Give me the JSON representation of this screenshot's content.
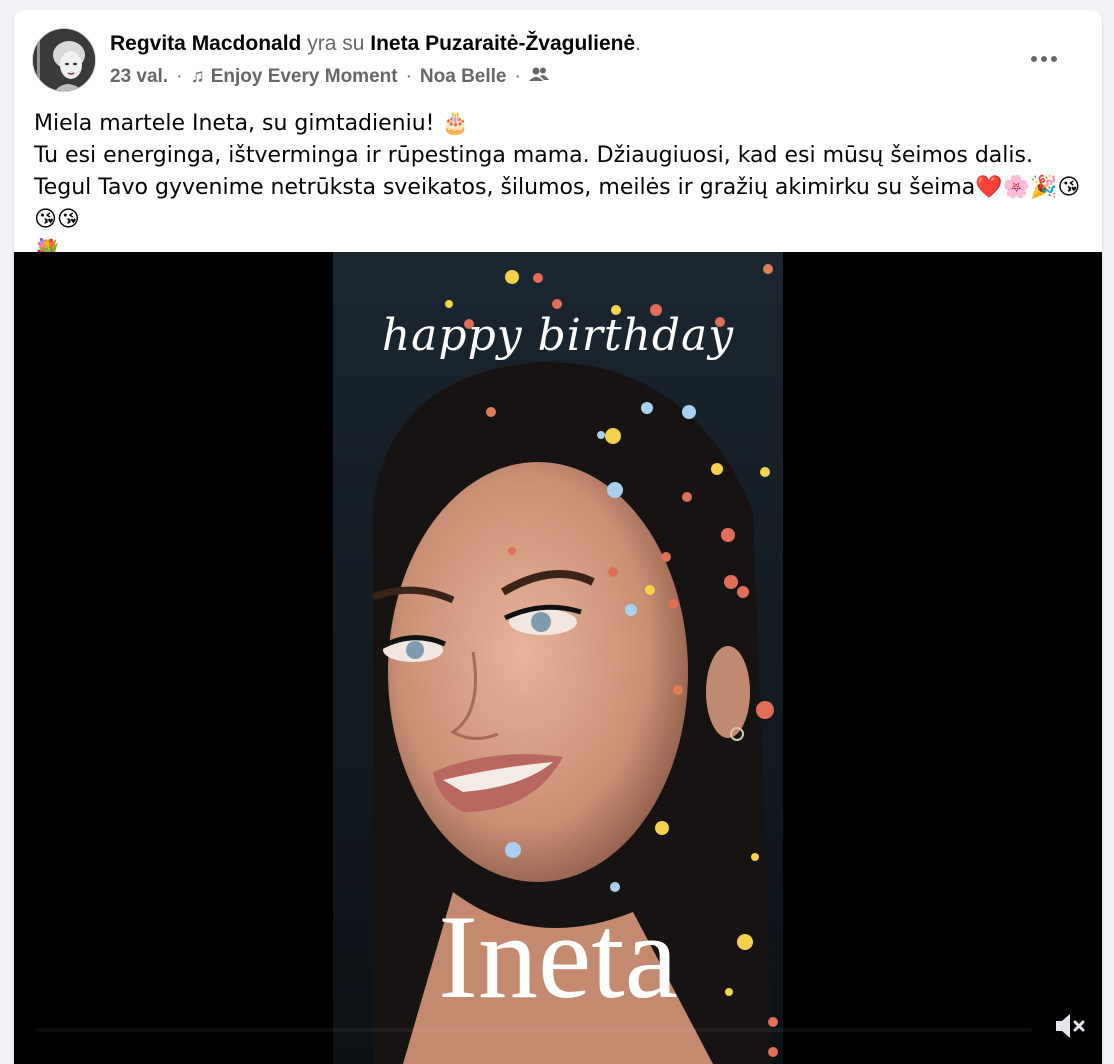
{
  "post": {
    "author": "Regvita Macdonald",
    "with_text": "yra su",
    "tagged": "Ineta Puzaraitė-Žvagulienė",
    "tagged_suffix": ".",
    "time": "23 val.",
    "dot": "·",
    "music_icon": "music-note-icon",
    "song": "Enjoy Every Moment",
    "artist": "Noa Belle",
    "audience_icon": "friends-icon",
    "more_icon": "more-options-icon",
    "text_line1": "Miela martele Ineta, su gimtadieniu! 🎂",
    "text_line2": "Tu esi energinga, ištverminga ir rūpestinga mama. Džiaugiuosi, kad esi mūsų šeimos dalis. Tegul Tavo gyvenime netrūksta sveikatos, šilumos, meilės ir gražių akimirku su šeima❤️🌸🎉😘😘😘",
    "text_line3": "💐"
  },
  "video": {
    "overlay_top": "happy birthday",
    "overlay_name": "Ineta",
    "mute_icon": "speaker-muted-icon"
  },
  "colors": {
    "background": "#f0f2f5",
    "text": "#050505",
    "secondary": "#65676b",
    "video_bg": "#000000"
  }
}
